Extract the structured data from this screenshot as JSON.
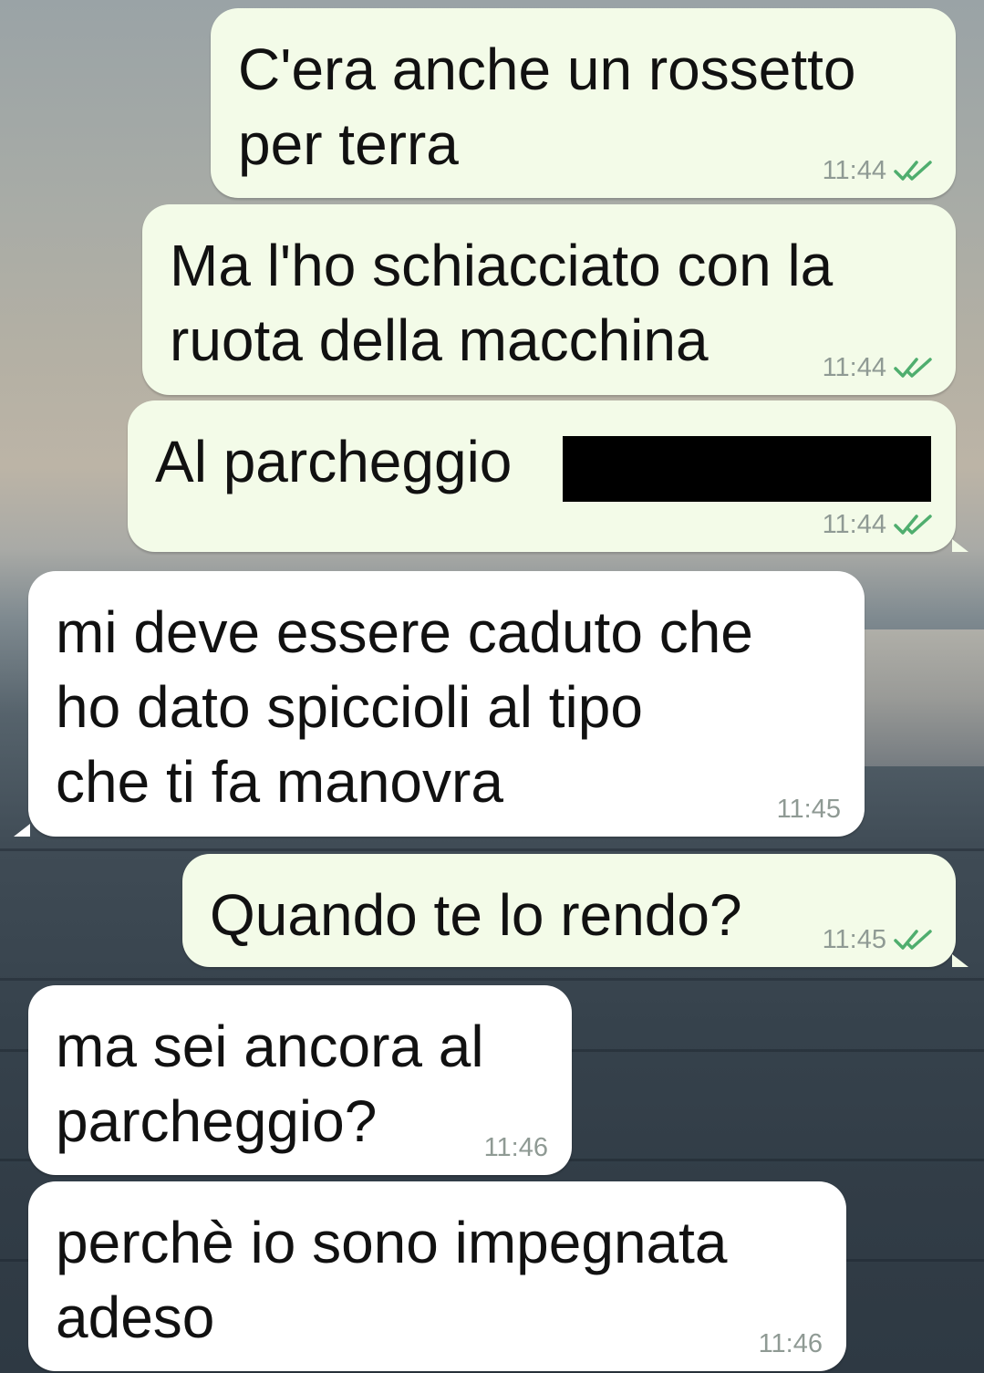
{
  "messages": [
    {
      "direction": "out",
      "text": "C'era anche un rossetto\nper terra",
      "time": "11:44",
      "status_icon": "double-check-read-icon"
    },
    {
      "direction": "out",
      "text": "Ma l'ho schiacciato con la\nruota della macchina",
      "time": "11:44",
      "status_icon": "double-check-read-icon"
    },
    {
      "direction": "out",
      "text": "Al parcheggio",
      "time": "11:44",
      "status_icon": "double-check-read-icon",
      "redacted": true
    },
    {
      "direction": "in",
      "text": "mi deve essere caduto che\nho dato spiccioli al tipo\nche ti fa manovra",
      "time": "11:45"
    },
    {
      "direction": "out",
      "text": "Quando te lo rendo?",
      "time": "11:45",
      "status_icon": "double-check-read-icon"
    },
    {
      "direction": "in",
      "text": "ma sei ancora al\nparcheggio?",
      "time": "11:46"
    },
    {
      "direction": "in",
      "text": "perchè io sono impegnata\nadeso",
      "time": "11:46"
    }
  ],
  "colors": {
    "outgoing_bubble": "#f3fbe8",
    "incoming_bubble": "#ffffff",
    "tick_color": "#4fae6e",
    "timestamp_color": "#8f9a94"
  }
}
